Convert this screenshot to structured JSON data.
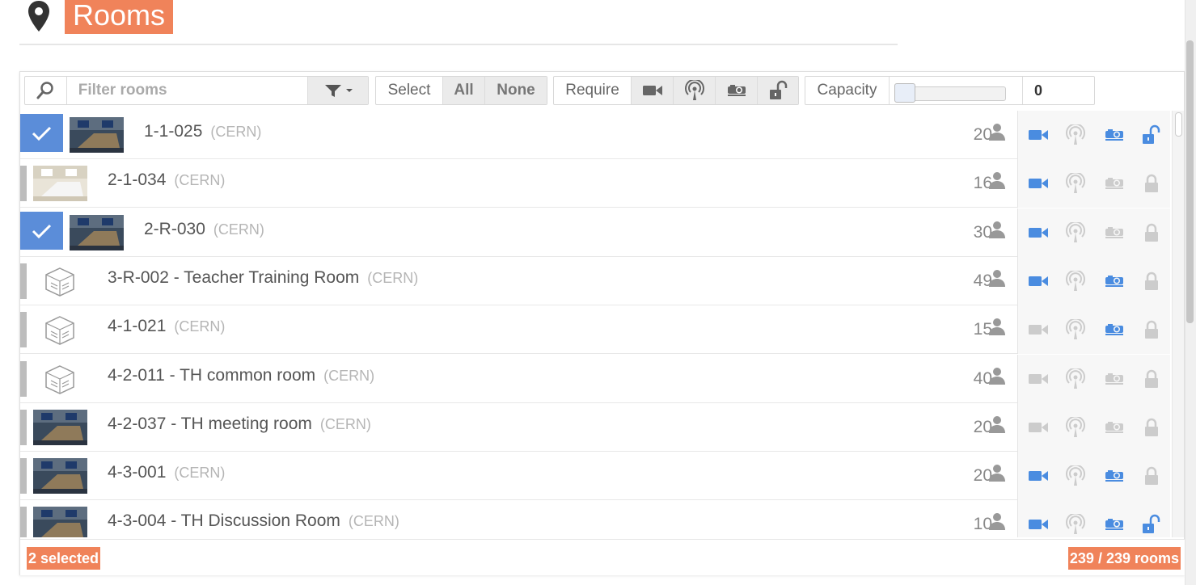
{
  "header": {
    "title": "Rooms",
    "icon": "map-pin-icon"
  },
  "toolbar": {
    "filter_placeholder": "Filter rooms",
    "select_label": "Select",
    "select_all": "All",
    "select_none": "None",
    "require_label": "Require",
    "capacity_label": "Capacity",
    "capacity_value": "0"
  },
  "rooms": [
    {
      "name": "1-1-025",
      "site": "(CERN)",
      "capacity": "20",
      "selected": true,
      "thumb": "photo",
      "vc": true,
      "webcast": false,
      "projector": true,
      "public": true
    },
    {
      "name": "2-1-034",
      "site": "(CERN)",
      "capacity": "16",
      "selected": false,
      "thumb": "photo-light",
      "vc": true,
      "webcast": false,
      "projector": false,
      "public": false
    },
    {
      "name": "2-R-030",
      "site": "(CERN)",
      "capacity": "30",
      "selected": true,
      "thumb": "photo",
      "vc": true,
      "webcast": false,
      "projector": false,
      "public": false
    },
    {
      "name": "3-R-002 - Teacher Training Room",
      "site": "(CERN)",
      "capacity": "49",
      "selected": false,
      "thumb": "placeholder",
      "vc": true,
      "webcast": false,
      "projector": true,
      "public": false
    },
    {
      "name": "4-1-021",
      "site": "(CERN)",
      "capacity": "15",
      "selected": false,
      "thumb": "placeholder",
      "vc": false,
      "webcast": false,
      "projector": true,
      "public": false
    },
    {
      "name": "4-2-011 - TH common room",
      "site": "(CERN)",
      "capacity": "40",
      "selected": false,
      "thumb": "placeholder",
      "vc": false,
      "webcast": false,
      "projector": false,
      "public": false
    },
    {
      "name": "4-2-037 - TH meeting room",
      "site": "(CERN)",
      "capacity": "20",
      "selected": false,
      "thumb": "photo",
      "vc": false,
      "webcast": false,
      "projector": false,
      "public": false
    },
    {
      "name": "4-3-001",
      "site": "(CERN)",
      "capacity": "20",
      "selected": false,
      "thumb": "photo",
      "vc": true,
      "webcast": false,
      "projector": true,
      "public": false
    },
    {
      "name": "4-3-004 - TH Discussion Room",
      "site": "(CERN)",
      "capacity": "10",
      "selected": false,
      "thumb": "photo",
      "vc": true,
      "webcast": false,
      "projector": true,
      "public": true
    }
  ],
  "footer": {
    "selected_text": "2 selected",
    "count_text": "239 / 239 rooms"
  },
  "colors": {
    "accent": "#f0835a",
    "active_feature": "#4a8ce0",
    "inactive_feature": "#cccccc",
    "selected_check": "#5b8dd9"
  }
}
